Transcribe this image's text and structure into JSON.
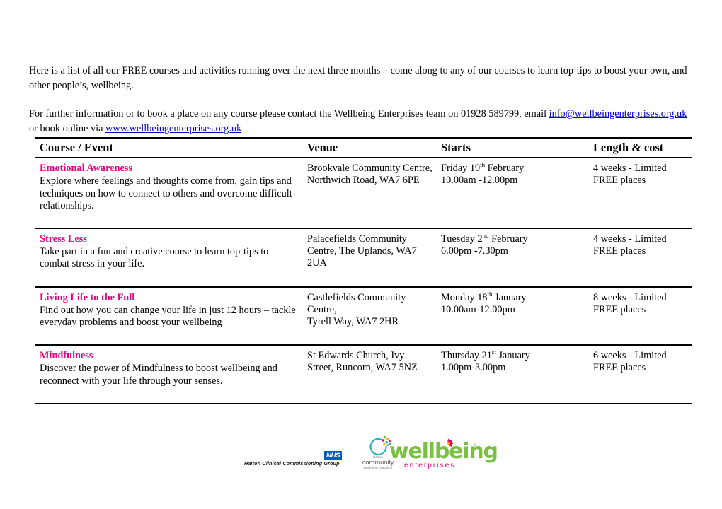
{
  "colors": {
    "course_title_pink": "#E5007D",
    "link_blue": "#0000cc",
    "nhs_blue": "#005EB8",
    "wellbeing_green": "#7AC143",
    "enterprises_pink": "#E5007D"
  },
  "intro": {
    "paragraph1": "Here is a list of all our FREE courses and activities running over the next three months – come along to any of our courses to learn top-tips to boost your own, and other people’s, wellbeing.",
    "paragraph2_before": "For further information or to book a place on any course please contact the Wellbeing Enterprises team on 01928 589799, email ",
    "email_link": "info@wellbeingenterprises.org.uk",
    "paragraph2_middle": " or book online via ",
    "web_link": "www.wellbeingenterprises.org.uk"
  },
  "table": {
    "headers": {
      "course": "Course / Event",
      "venue": "Venue",
      "starts": "Starts",
      "length": "Length & cost"
    },
    "rows": [
      {
        "title": "Emotional Awareness",
        "description": "Explore where feelings and thoughts come from, gain tips and techniques on how to connect to others and overcome difficult relationships.",
        "venue": "Brookvale Community Centre, Northwich Road, WA7 6PE",
        "starts_day": "Friday 19",
        "starts_ordinal": "th",
        "starts_month": " February",
        "starts_time": "10.00am -12.00pm",
        "length": "4 weeks - Limited FREE places"
      },
      {
        "title": "Stress Less",
        "description": "Take part in a fun and creative course to learn top-tips to combat stress in your life.",
        "venue": "Palacefields Community Centre, The Uplands, WA7 2UA",
        "starts_day": "Tuesday 2",
        "starts_ordinal": "nd",
        "starts_month": " February",
        "starts_time": "6.00pm -7.30pm",
        "length": "4 weeks - Limited FREE places"
      },
      {
        "title": "Living Life to the Full",
        "description": "Find out how you can change your life in just 12 hours – tackle everyday problems and boost your wellbeing",
        "venue": "Castlefields Community Centre,\nTyrell Way, WA7 2HR",
        "starts_day": "Monday 18",
        "starts_ordinal": "th",
        "starts_month": " January",
        "starts_time": "10.00am-12.00pm",
        "length": "8 weeks - Limited FREE places"
      },
      {
        "title": "Mindfulness",
        "description": "Discover the power of Mindfulness to boost wellbeing and reconnect with your life through your senses.",
        "venue": "St Edwards Church, Ivy Street, Runcorn, WA7 5NZ",
        "starts_day": "Thursday 21",
        "starts_ordinal": "st",
        "starts_month": " January",
        "starts_time": "1.00pm-3.00pm",
        "length": "6 weeks - Limited FREE places"
      }
    ]
  },
  "footer": {
    "ccg_name": "Halton Clinical Commissioning Group",
    "nhs_badge": "NHS",
    "hcwp_halton": "Halton",
    "hcwp_community": "community",
    "hcwp_practices": "wellbeing practices",
    "wellbeing_word": "wellbeing",
    "wellbeing_reg": "®",
    "enterprises_word": "enterprises",
    "trailing_dots": ".."
  }
}
